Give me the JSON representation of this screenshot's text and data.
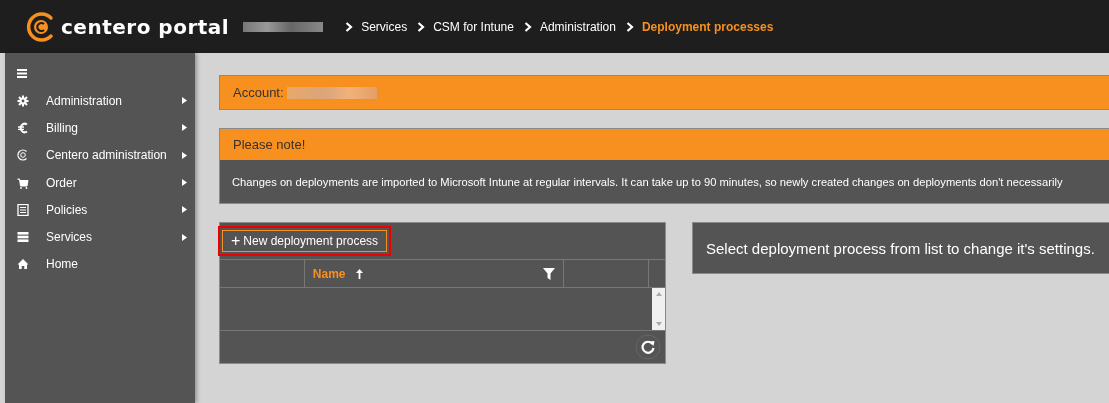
{
  "header": {
    "logo": "centero portal",
    "breadcrumbs": [
      "Services",
      "CSM for Intune",
      "Administration"
    ],
    "current_page": "Deployment processes"
  },
  "sidebar": {
    "items": [
      {
        "kind": "gear",
        "label": "Administration",
        "submenu": true
      },
      {
        "kind": "euro",
        "label": "Billing",
        "submenu": true
      },
      {
        "kind": "centero",
        "label": "Centero administration",
        "submenu": true
      },
      {
        "kind": "cart",
        "label": "Order",
        "submenu": true
      },
      {
        "kind": "list",
        "label": "Policies",
        "submenu": true
      },
      {
        "kind": "server",
        "label": "Services",
        "submenu": true
      },
      {
        "kind": "home",
        "label": "Home",
        "submenu": false
      }
    ]
  },
  "account": {
    "label": "Account:"
  },
  "note": {
    "title": "Please note!",
    "text": "Changes on deployments are imported to Microsoft Intune at regular intervals. It can take up to 90 minutes, so newly created changes on deployments don't necessarily"
  },
  "grid": {
    "new_button": {
      "icon": "+",
      "label": "New deployment process",
      "highlighted": true
    },
    "columns": [
      {
        "label": "Name",
        "sorted_ascending": true,
        "filter": true
      }
    ]
  },
  "details": {
    "message": "Select deployment process from list to change it's settings."
  }
}
